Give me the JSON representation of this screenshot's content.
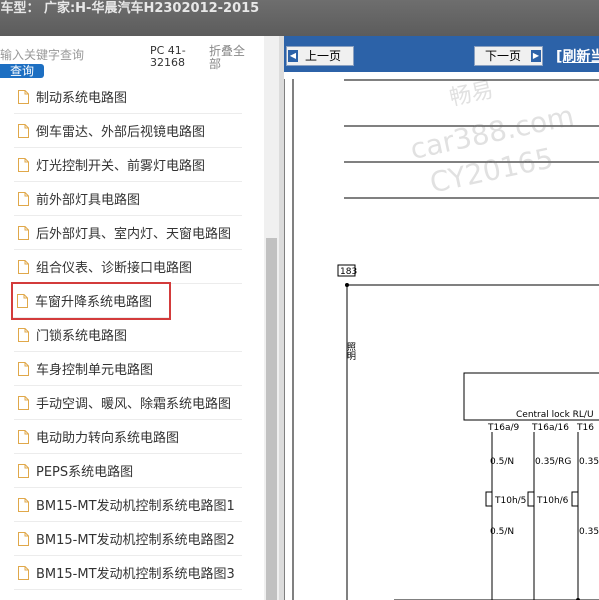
{
  "header": {
    "title": "j车型： 广家:H-华晨汽车H2302012-2015"
  },
  "sidebar": {
    "search_placeholder": "输入关键字查询",
    "search_button": "查询",
    "pc_code": "PC 41-32168",
    "collapse_label": "折叠全部",
    "items": [
      {
        "label": "制动系统电路图"
      },
      {
        "label": "倒车雷达、外部后视镜电路图"
      },
      {
        "label": "灯光控制开关、前雾灯电路图"
      },
      {
        "label": "前外部灯具电路图"
      },
      {
        "label": "后外部灯具、室内灯、天窗电路图"
      },
      {
        "label": "组合仪表、诊断接口电路图"
      },
      {
        "label": "车窗升降系统电路图"
      },
      {
        "label": "门锁系统电路图"
      },
      {
        "label": "车身控制单元电路图"
      },
      {
        "label": "手动空调、暖风、除霜系统电路图"
      },
      {
        "label": "电动助力转向系统电路图"
      },
      {
        "label": "PEPS系统电路图"
      },
      {
        "label": "BM15-MT发动机控制系统电路图1"
      },
      {
        "label": "BM15-MT发动机控制系统电路图2"
      },
      {
        "label": "BM15-MT发动机控制系统电路图3"
      }
    ],
    "selected_index": 6
  },
  "viewer": {
    "prev_label": "上一页",
    "next_label": "下一页",
    "refresh_label": "[刷新当",
    "diagram": {
      "number": "183",
      "label_vertical": "照明",
      "component": "Central lock RL/U",
      "pins": [
        "T16a/9",
        "T16a/16",
        "T16"
      ],
      "wires_top": [
        "0.5/N",
        "0.35/RG",
        "0.35"
      ],
      "connectors": [
        "T10h/5",
        "T10h/6"
      ],
      "wires_bottom": [
        "0.5/N",
        "0.35"
      ]
    },
    "watermark": [
      "畅易",
      "car388.com",
      "CY20165"
    ]
  },
  "colors": {
    "accent": "#2c62a8",
    "selection": "#d33b3b",
    "search_button": "#1d6fc2"
  }
}
